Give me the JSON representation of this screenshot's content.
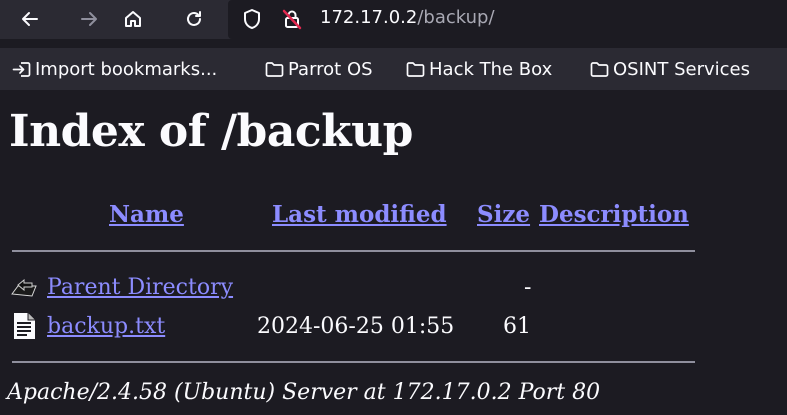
{
  "browser": {
    "url_host": "172.17.0.2",
    "url_path": "/backup/",
    "bookmarks": [
      {
        "label": "Import bookmarks...",
        "icon": "import-icon"
      },
      {
        "label": "Parrot OS",
        "icon": "folder-icon"
      },
      {
        "label": "Hack The Box",
        "icon": "folder-icon"
      },
      {
        "label": "OSINT Services",
        "icon": "folder-icon"
      }
    ]
  },
  "page": {
    "title": "Index of /backup",
    "columns": {
      "name": "Name",
      "last_modified": "Last modified",
      "size": "Size",
      "description": "Description"
    },
    "rows": [
      {
        "name": "Parent Directory",
        "last_modified": "",
        "size": "-",
        "description": "",
        "icon": "back-folder-icon"
      },
      {
        "name": "backup.txt",
        "last_modified": "2024-06-25 01:55",
        "size": "61",
        "description": "",
        "icon": "text-file-icon"
      }
    ],
    "footer": "Apache/2.4.58 (Ubuntu) Server at 172.17.0.2 Port 80"
  },
  "colors": {
    "background": "#1c1b22",
    "toolbar": "#2b2a33",
    "link": "#8c8cff",
    "text": "#fbfbfe"
  }
}
